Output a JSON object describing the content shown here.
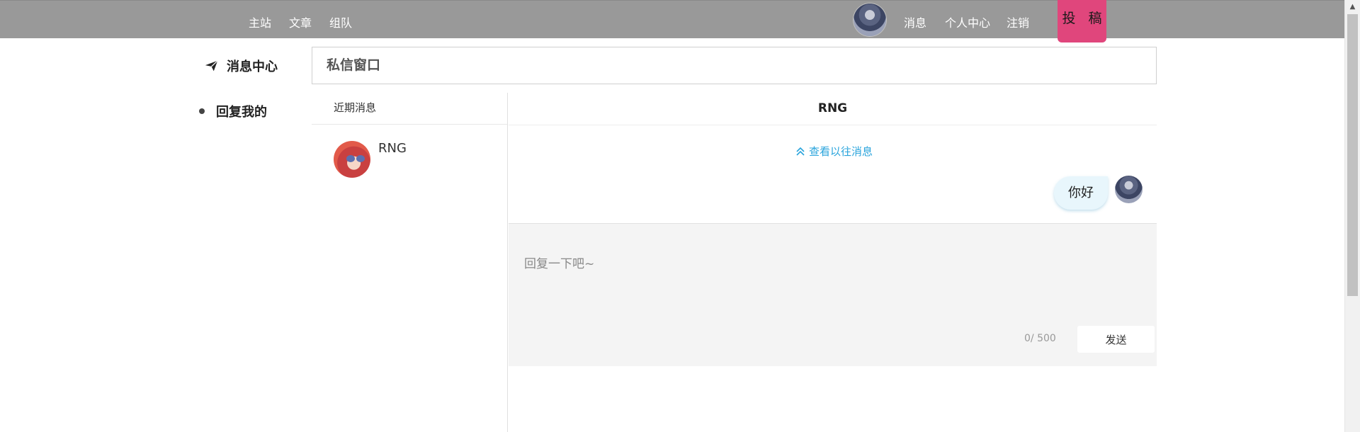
{
  "nav": {
    "links_left": [
      "主站",
      "文章",
      "组队"
    ],
    "links_right": [
      "消息",
      "个人中心",
      "注销"
    ],
    "submit_label": "投 稿"
  },
  "sidebar": {
    "title": "消息中心",
    "title_icon": "paper-plane-icon",
    "items": [
      {
        "label": "回复我的"
      }
    ]
  },
  "window": {
    "title": "私信窗口"
  },
  "contacts": {
    "header": "近期消息",
    "items": [
      {
        "name": "RNG"
      }
    ]
  },
  "chat": {
    "partner_name": "RNG",
    "history_link": "查看以往消息",
    "history_icon": "double-chevron-up-icon",
    "messages": [
      {
        "text": "你好",
        "from": "me"
      }
    ]
  },
  "reply": {
    "placeholder": "回复一下吧~",
    "value": "",
    "counter": "0/ 500",
    "send_label": "发送"
  },
  "colors": {
    "topbar": "#999999",
    "submit_button": "#e0467c",
    "link_accent": "#2aa4dc",
    "bubble": "#e8f6fc",
    "reply_bg": "#f4f4f4"
  }
}
